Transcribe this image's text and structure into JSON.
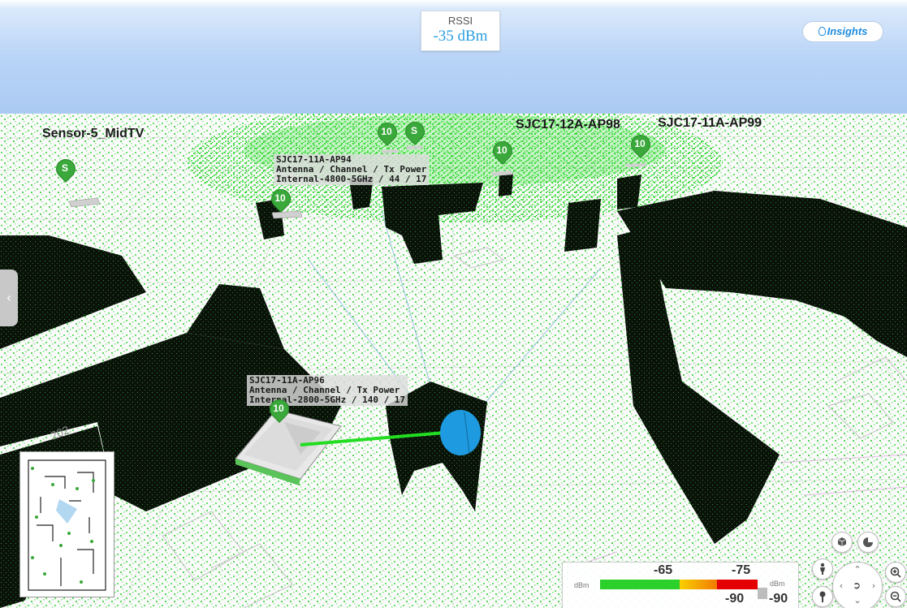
{
  "rssi": {
    "label": "RSSI",
    "value": "-35 dBm"
  },
  "insights": {
    "label": "Insights",
    "icon": "lightbulb-icon"
  },
  "labels": {
    "sensor": "Sensor-5_MidTV",
    "ap98": "SJC17-12A-AP98",
    "ap99": "SJC17-11A-AP99",
    "floor_text": "202"
  },
  "ap94_info": {
    "name": "SJC17-11A-AP94",
    "header": "Antenna  /  Channel  /  Tx Power",
    "values": "Internal-4800-5GHz / 44 / 17"
  },
  "ap96_info": {
    "name": "SJC17-11A-AP96",
    "header": "Antenna  /  Channel  /  Tx Power",
    "values": "Internal-2800-5GHz / 140 / 17"
  },
  "markers": [
    {
      "text": "S"
    },
    {
      "text": "10"
    },
    {
      "text": "S"
    },
    {
      "text": "10"
    },
    {
      "text": "10"
    },
    {
      "text": "10"
    },
    {
      "text": "10"
    }
  ],
  "legend": {
    "unit_left": "dBm",
    "unit_right": "dBm",
    "value_mid": "-65",
    "value_high": "-75",
    "value_low_a": "-90",
    "value_low_b": "-90"
  },
  "colors": {
    "coverage_green": "#22dd22",
    "wall_dark": "#0b130b",
    "marker_green": "#3aa83a",
    "rssi_blue": "#2a9fe0",
    "sky_blue": "#a9c9f2"
  },
  "controls": {
    "view_3d": "cube-icon",
    "heatmap": "pie-chart-icon",
    "person": "person-icon",
    "pin": "location-pin-icon",
    "zoom_in": "zoom-in-icon",
    "zoom_out": "zoom-out-icon",
    "nav": "navigation-pad-icon"
  }
}
